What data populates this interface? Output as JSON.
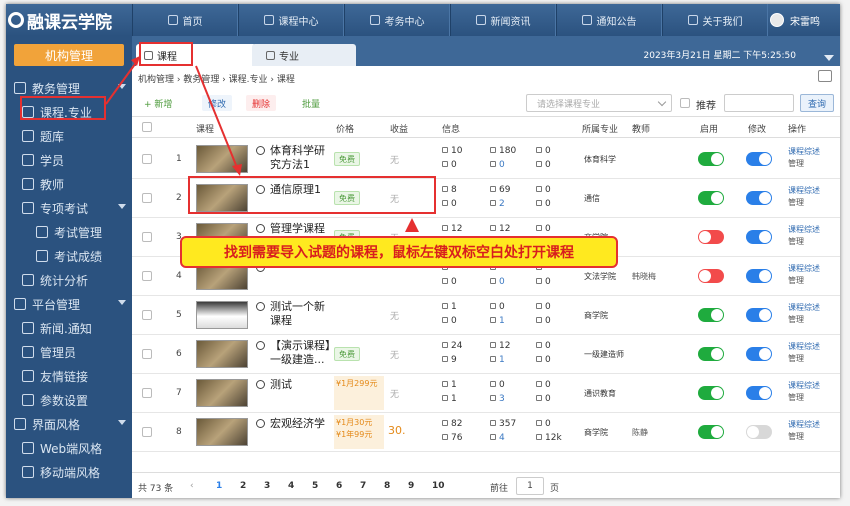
{
  "app_title": "融课云学院",
  "nav": [
    "首页",
    "课程中心",
    "考务中心",
    "新闻资讯",
    "通知公告",
    "关于我们"
  ],
  "user_name": "宋雷鸣",
  "org_button": "机构管理",
  "sidebar": [
    {
      "label": "教务管理",
      "kind": "group"
    },
    {
      "label": "课程.专业",
      "kind": "sub"
    },
    {
      "label": "题库",
      "kind": "sub"
    },
    {
      "label": "学员",
      "kind": "sub"
    },
    {
      "label": "教师",
      "kind": "sub"
    },
    {
      "label": "专项考试",
      "kind": "subgroup"
    },
    {
      "label": "考试管理",
      "kind": "sub2"
    },
    {
      "label": "考试成绩",
      "kind": "sub2"
    },
    {
      "label": "统计分析",
      "kind": "sub"
    },
    {
      "label": "平台管理",
      "kind": "group"
    },
    {
      "label": "新闻.通知",
      "kind": "sub"
    },
    {
      "label": "管理员",
      "kind": "sub"
    },
    {
      "label": "友情链接",
      "kind": "sub"
    },
    {
      "label": "参数设置",
      "kind": "sub"
    },
    {
      "label": "界面风格",
      "kind": "group"
    },
    {
      "label": "Web端风格",
      "kind": "sub"
    },
    {
      "label": "移动端风格",
      "kind": "sub"
    }
  ],
  "tabs": [
    "课程",
    "专业"
  ],
  "datetime": "2023年3月21日 星期二 下午5:25:50",
  "breadcrumb": "机构管理 › 教务管理 › 课程.专业 › 课程",
  "toolbar": {
    "add": "+ 新增",
    "edit": "修改",
    "del": "删除",
    "batch": "批量",
    "select_placeholder": "请选择课程专业",
    "recommend": "推荐",
    "query": "查询"
  },
  "columns": {
    "course": "课程",
    "price": "价格",
    "gain": "收益",
    "info": "信息",
    "major": "所属专业",
    "teacher": "教师",
    "enable": "启用",
    "edit": "修改",
    "op": "操作"
  },
  "rows": [
    {
      "n": "1",
      "title": "体育科学研究方法1",
      "price": "免费",
      "gain": "无",
      "i1": "10",
      "i2": "0",
      "i3": "180",
      "i4": "0",
      "i5": "0",
      "i6": "0",
      "major": "体育科学",
      "teacher": "",
      "enable": "on",
      "edit": "on"
    },
    {
      "n": "2",
      "title": "通信原理1",
      "price": "免费",
      "gain": "无",
      "i1": "8",
      "i2": "0",
      "i3": "69",
      "i4": "2",
      "i5": "0",
      "i6": "0",
      "major": "通信",
      "teacher": "",
      "enable": "on",
      "edit": "on"
    },
    {
      "n": "3",
      "title": "管理学课程",
      "price": "免费",
      "gain": "无",
      "i1": "12",
      "i2": "0",
      "i3": "12",
      "i4": "0",
      "i5": "0",
      "i6": "0",
      "major": "商学院",
      "teacher": "",
      "enable": "off-red",
      "edit": "on"
    },
    {
      "n": "4",
      "title": "",
      "price": "",
      "gain": "",
      "i1": "",
      "i2": "0",
      "i3": "",
      "i4": "0",
      "i5": "",
      "i6": "0",
      "major": "文法学院",
      "teacher": "韩晓梅",
      "enable": "off-red",
      "edit": "on"
    },
    {
      "n": "5",
      "title": "测试一个新课程",
      "price": "",
      "gain": "无",
      "i1": "1",
      "i2": "0",
      "i3": "0",
      "i4": "1",
      "i5": "0",
      "i6": "0",
      "major": "商学院",
      "teacher": "",
      "enable": "on",
      "edit": "on"
    },
    {
      "n": "6",
      "title": "【演示课程】一级建造...",
      "price": "免费",
      "gain": "无",
      "i1": "24",
      "i2": "9",
      "i3": "12",
      "i4": "1",
      "i5": "0",
      "i6": "0",
      "major": "一级建造师",
      "teacher": "",
      "enable": "on",
      "edit": "on"
    },
    {
      "n": "7",
      "title": "测试",
      "price": "¥1月299元",
      "gain": "无",
      "i1": "1",
      "i2": "1",
      "i3": "0",
      "i4": "3",
      "i5": "0",
      "i6": "0",
      "major": "通识教育",
      "teacher": "",
      "enable": "on",
      "edit": "on"
    },
    {
      "n": "8",
      "title": "宏观经济学",
      "price": "¥1月30元 ¥1年99元",
      "gain": "30.",
      "i1": "82",
      "i2": "76",
      "i3": "357",
      "i4": "4",
      "i5": "0",
      "i6": "12k",
      "major": "商学院",
      "teacher": "陈静",
      "enable": "on",
      "edit": "off"
    }
  ],
  "op_link": "课程综述",
  "op_manage": "管理",
  "footer": {
    "total": "共 73 条",
    "pages": [
      "1",
      "2",
      "3",
      "4",
      "5",
      "6",
      "7",
      "8",
      "9",
      "10"
    ],
    "goto": "前往",
    "page_input": "1",
    "page_suffix": "页"
  },
  "tip": "找到需要导入试题的课程，鼠标左键双标空白处打开课程",
  "colors": {
    "nav": "#2b527f",
    "accent": "#f1a33a",
    "on": "#1fab3e",
    "blue": "#2a7fe8",
    "red": "#f24b4b",
    "highlight": "#e53030",
    "tip_bg": "#ffe91f"
  }
}
